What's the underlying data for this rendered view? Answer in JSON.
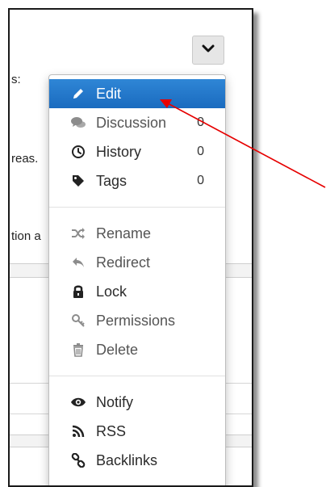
{
  "background_text": {
    "line1": "s:",
    "line2": "reas.",
    "line3": "tion a"
  },
  "toggle": {
    "icon": "chevron-down-icon"
  },
  "menu": {
    "groups": [
      [
        {
          "label": "Edit",
          "icon": "pencil-icon",
          "active": true,
          "count": ""
        },
        {
          "label": "Discussion",
          "icon": "comments-icon",
          "count": "0",
          "muted": true
        },
        {
          "label": "History",
          "icon": "clock-icon",
          "count": "0"
        },
        {
          "label": "Tags",
          "icon": "tag-icon",
          "count": "0"
        }
      ],
      [
        {
          "label": "Rename",
          "icon": "shuffle-icon",
          "muted": true
        },
        {
          "label": "Redirect",
          "icon": "reply-icon",
          "muted": true
        },
        {
          "label": "Lock",
          "icon": "lock-icon"
        },
        {
          "label": "Permissions",
          "icon": "key-icon",
          "muted": true
        },
        {
          "label": "Delete",
          "icon": "trash-icon",
          "muted": true
        }
      ],
      [
        {
          "label": "Notify",
          "icon": "eye-icon"
        },
        {
          "label": "RSS",
          "icon": "rss-icon"
        },
        {
          "label": "Backlinks",
          "icon": "link-icon"
        }
      ]
    ]
  },
  "colors": {
    "active_bg": "#1f75c9",
    "annotation_arrow": "#e60000"
  }
}
